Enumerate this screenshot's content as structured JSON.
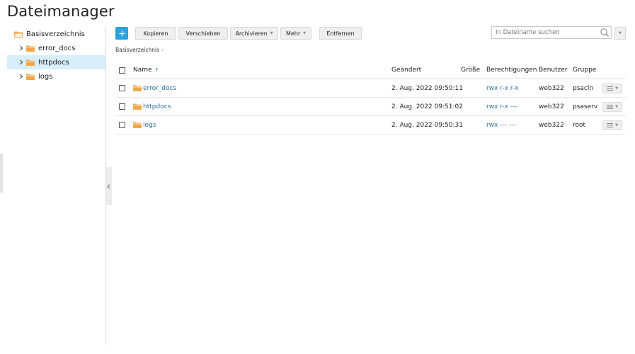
{
  "page_title": "Dateimanager",
  "sidebar": {
    "items": [
      {
        "label": "Basisverzeichnis",
        "icon": "folder-open-icon",
        "expandable": false,
        "selected": false
      },
      {
        "label": "error_docs",
        "icon": "folder-icon",
        "expandable": true,
        "selected": false
      },
      {
        "label": "httpdocs",
        "icon": "folder-icon",
        "expandable": true,
        "selected": true
      },
      {
        "label": "logs",
        "icon": "folder-icon",
        "expandable": true,
        "selected": false
      }
    ]
  },
  "toolbar": {
    "add_label": "+",
    "copy_label": "Kopieren",
    "move_label": "Verschieben",
    "archive_label": "Archivieren",
    "more_label": "Mehr",
    "remove_label": "Entfernen"
  },
  "search": {
    "placeholder": "In Dateiname suchen"
  },
  "breadcrumb": {
    "root": "Basisverzeichnis",
    "separator": "›"
  },
  "table": {
    "headers": {
      "name": "Name",
      "modified": "Geändert",
      "size": "Größe",
      "permissions": "Berechtigungen",
      "user": "Benutzer",
      "group": "Gruppe"
    },
    "sort_indicator": "↑",
    "rows": [
      {
        "name": "error_docs",
        "modified": "2. Aug. 2022 09:50:11",
        "size": "",
        "permissions": "rwx r-x r-x",
        "user": "web322",
        "group": "psacln"
      },
      {
        "name": "httpdocs",
        "modified": "2. Aug. 2022 09:51:02",
        "size": "",
        "permissions": "rwx r-x ---",
        "user": "web322",
        "group": "psaserv"
      },
      {
        "name": "logs",
        "modified": "2. Aug. 2022 09:50:31",
        "size": "",
        "permissions": "rwx --- ---",
        "user": "web322",
        "group": "root"
      }
    ]
  },
  "colors": {
    "accent": "#2aa3dc",
    "link": "#2d6e9b",
    "folder": "#f0a84a",
    "selected_bg": "#d8effa"
  }
}
